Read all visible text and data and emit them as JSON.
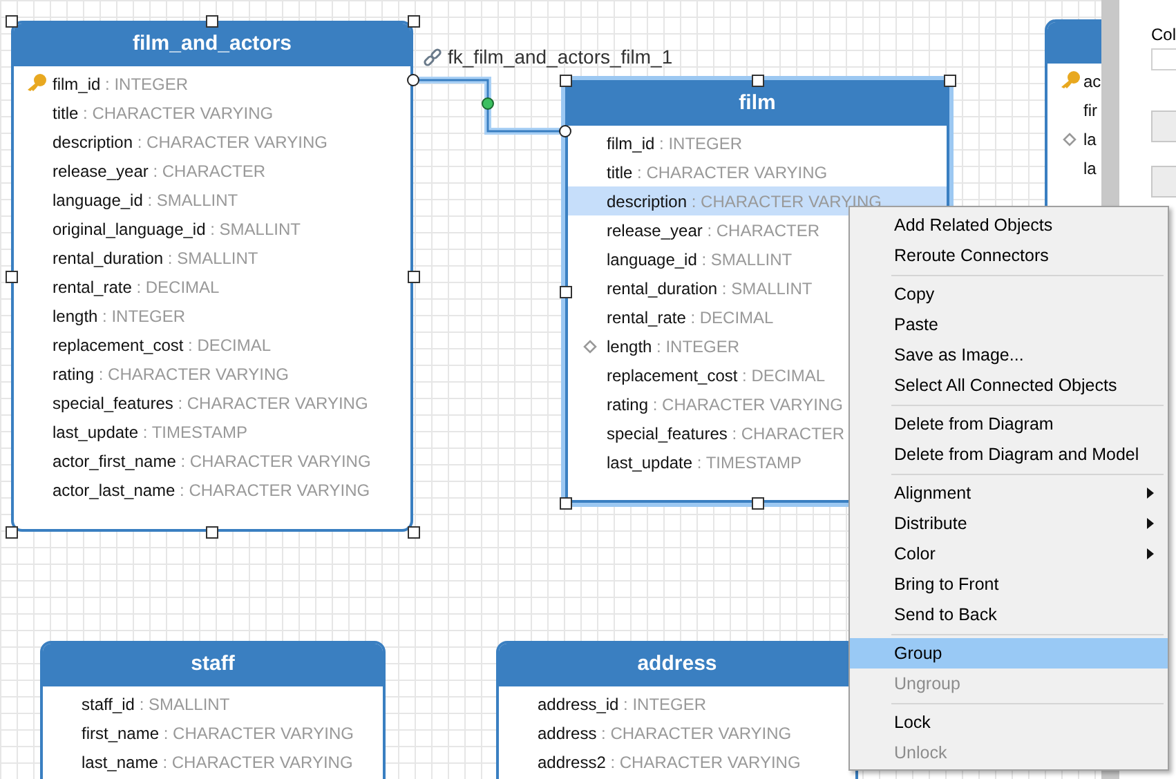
{
  "tables": [
    {
      "name": "film_and_actors",
      "selected": true,
      "focused": false,
      "columns": [
        {
          "name": "film_id",
          "type": ": INTEGER",
          "kind": "key",
          "selected": false
        },
        {
          "name": "title",
          "type": ": CHARACTER VARYING",
          "kind": "plain",
          "selected": false
        },
        {
          "name": "description",
          "type": ": CHARACTER VARYING",
          "kind": "plain",
          "selected": false
        },
        {
          "name": "release_year",
          "type": ": CHARACTER",
          "kind": "plain",
          "selected": false
        },
        {
          "name": "language_id",
          "type": ": SMALLINT",
          "kind": "plain",
          "selected": false
        },
        {
          "name": "original_language_id",
          "type": ": SMALLINT",
          "kind": "plain",
          "selected": false
        },
        {
          "name": "rental_duration",
          "type": ": SMALLINT",
          "kind": "plain",
          "selected": false
        },
        {
          "name": "rental_rate",
          "type": ": DECIMAL",
          "kind": "plain",
          "selected": false
        },
        {
          "name": "length",
          "type": ": INTEGER",
          "kind": "plain",
          "selected": false
        },
        {
          "name": "replacement_cost",
          "type": ": DECIMAL",
          "kind": "plain",
          "selected": false
        },
        {
          "name": "rating",
          "type": ": CHARACTER VARYING",
          "kind": "plain",
          "selected": false
        },
        {
          "name": "special_features",
          "type": ": CHARACTER VARYING",
          "kind": "plain",
          "selected": false
        },
        {
          "name": "last_update",
          "type": ": TIMESTAMP",
          "kind": "plain",
          "selected": false
        },
        {
          "name": "actor_first_name",
          "type": ": CHARACTER VARYING",
          "kind": "plain",
          "selected": false
        },
        {
          "name": "actor_last_name",
          "type": ": CHARACTER VARYING",
          "kind": "plain",
          "selected": false
        }
      ]
    },
    {
      "name": "film",
      "selected": true,
      "focused": true,
      "columns": [
        {
          "name": "film_id",
          "type": ": INTEGER",
          "kind": "plain",
          "selected": false
        },
        {
          "name": "title",
          "type": ": CHARACTER VARYING",
          "kind": "plain",
          "selected": false
        },
        {
          "name": "description",
          "type": ": CHARACTER VARYING",
          "kind": "plain",
          "selected": true
        },
        {
          "name": "release_year",
          "type": ": CHARACTER",
          "kind": "plain",
          "selected": false
        },
        {
          "name": "language_id",
          "type": ": SMALLINT",
          "kind": "plain",
          "selected": false
        },
        {
          "name": "rental_duration",
          "type": ": SMALLINT",
          "kind": "plain",
          "selected": false
        },
        {
          "name": "rental_rate",
          "type": ": DECIMAL",
          "kind": "plain",
          "selected": false
        },
        {
          "name": "length",
          "type": ": INTEGER",
          "kind": "diamond",
          "selected": false
        },
        {
          "name": "replacement_cost",
          "type": ": DECIMAL",
          "kind": "plain",
          "selected": false
        },
        {
          "name": "rating",
          "type": ": CHARACTER VARYING",
          "kind": "plain",
          "selected": false
        },
        {
          "name": "special_features",
          "type": ": CHARACTER",
          "kind": "plain",
          "selected": false
        },
        {
          "name": "last_update",
          "type": ": TIMESTAMP",
          "kind": "plain",
          "selected": false
        }
      ]
    },
    {
      "name": "staff",
      "selected": false,
      "focused": false,
      "columns": [
        {
          "name": "staff_id",
          "type": ": SMALLINT",
          "kind": "plain",
          "selected": false
        },
        {
          "name": "first_name",
          "type": ": CHARACTER VARYING",
          "kind": "plain",
          "selected": false
        },
        {
          "name": "last_name",
          "type": ": CHARACTER VARYING",
          "kind": "plain",
          "selected": false
        }
      ]
    },
    {
      "name": "address",
      "selected": false,
      "focused": false,
      "columns": [
        {
          "name": "address_id",
          "type": ": INTEGER",
          "kind": "plain",
          "selected": false
        },
        {
          "name": "address",
          "type": ": CHARACTER VARYING",
          "kind": "plain",
          "selected": false
        },
        {
          "name": "address2",
          "type": ": CHARACTER VARYING",
          "kind": "plain",
          "selected": false
        }
      ]
    },
    {
      "selected": false,
      "focused": false,
      "columns": [
        {
          "name": "ac",
          "kind": "key",
          "selected": false
        },
        {
          "name": "fir",
          "kind": "plain",
          "selected": false
        },
        {
          "name": "la",
          "kind": "diamond",
          "selected": false
        },
        {
          "name": "la",
          "kind": "plain",
          "selected": false
        }
      ]
    }
  ],
  "connector": {
    "label": "fk_film_and_actors_film_1"
  },
  "context_menu": [
    {
      "kind": "item",
      "label": "Add Related Objects",
      "disabled": false,
      "selected": false,
      "submenu": false
    },
    {
      "kind": "item",
      "label": "Reroute Connectors",
      "disabled": false,
      "selected": false,
      "submenu": false
    },
    {
      "kind": "separator"
    },
    {
      "kind": "item",
      "label": "Copy",
      "disabled": false,
      "selected": false,
      "submenu": false
    },
    {
      "kind": "item",
      "label": "Paste",
      "disabled": false,
      "selected": false,
      "submenu": false
    },
    {
      "kind": "item",
      "label": "Save as Image...",
      "disabled": false,
      "selected": false,
      "submenu": false
    },
    {
      "kind": "item",
      "label": "Select All Connected Objects",
      "disabled": false,
      "selected": false,
      "submenu": false
    },
    {
      "kind": "separator"
    },
    {
      "kind": "item",
      "label": "Delete from Diagram",
      "disabled": false,
      "selected": false,
      "submenu": false
    },
    {
      "kind": "item",
      "label": "Delete from Diagram and Model",
      "disabled": false,
      "selected": false,
      "submenu": false
    },
    {
      "kind": "separator"
    },
    {
      "kind": "item",
      "label": "Alignment",
      "disabled": false,
      "selected": false,
      "submenu": true
    },
    {
      "kind": "item",
      "label": "Distribute",
      "disabled": false,
      "selected": false,
      "submenu": true
    },
    {
      "kind": "item",
      "label": "Color",
      "disabled": false,
      "selected": false,
      "submenu": true
    },
    {
      "kind": "item",
      "label": "Bring to Front",
      "disabled": false,
      "selected": false,
      "submenu": false
    },
    {
      "kind": "item",
      "label": "Send to Back",
      "disabled": false,
      "selected": false,
      "submenu": false
    },
    {
      "kind": "separator"
    },
    {
      "kind": "item",
      "label": "Group",
      "disabled": false,
      "selected": true,
      "submenu": false
    },
    {
      "kind": "item",
      "label": "Ungroup",
      "disabled": true,
      "selected": false,
      "submenu": false
    },
    {
      "kind": "separator"
    },
    {
      "kind": "item",
      "label": "Lock",
      "disabled": false,
      "selected": false,
      "submenu": false
    },
    {
      "kind": "item",
      "label": "Unlock",
      "disabled": true,
      "selected": false,
      "submenu": false
    }
  ],
  "side_panel": {
    "label": "Col"
  }
}
